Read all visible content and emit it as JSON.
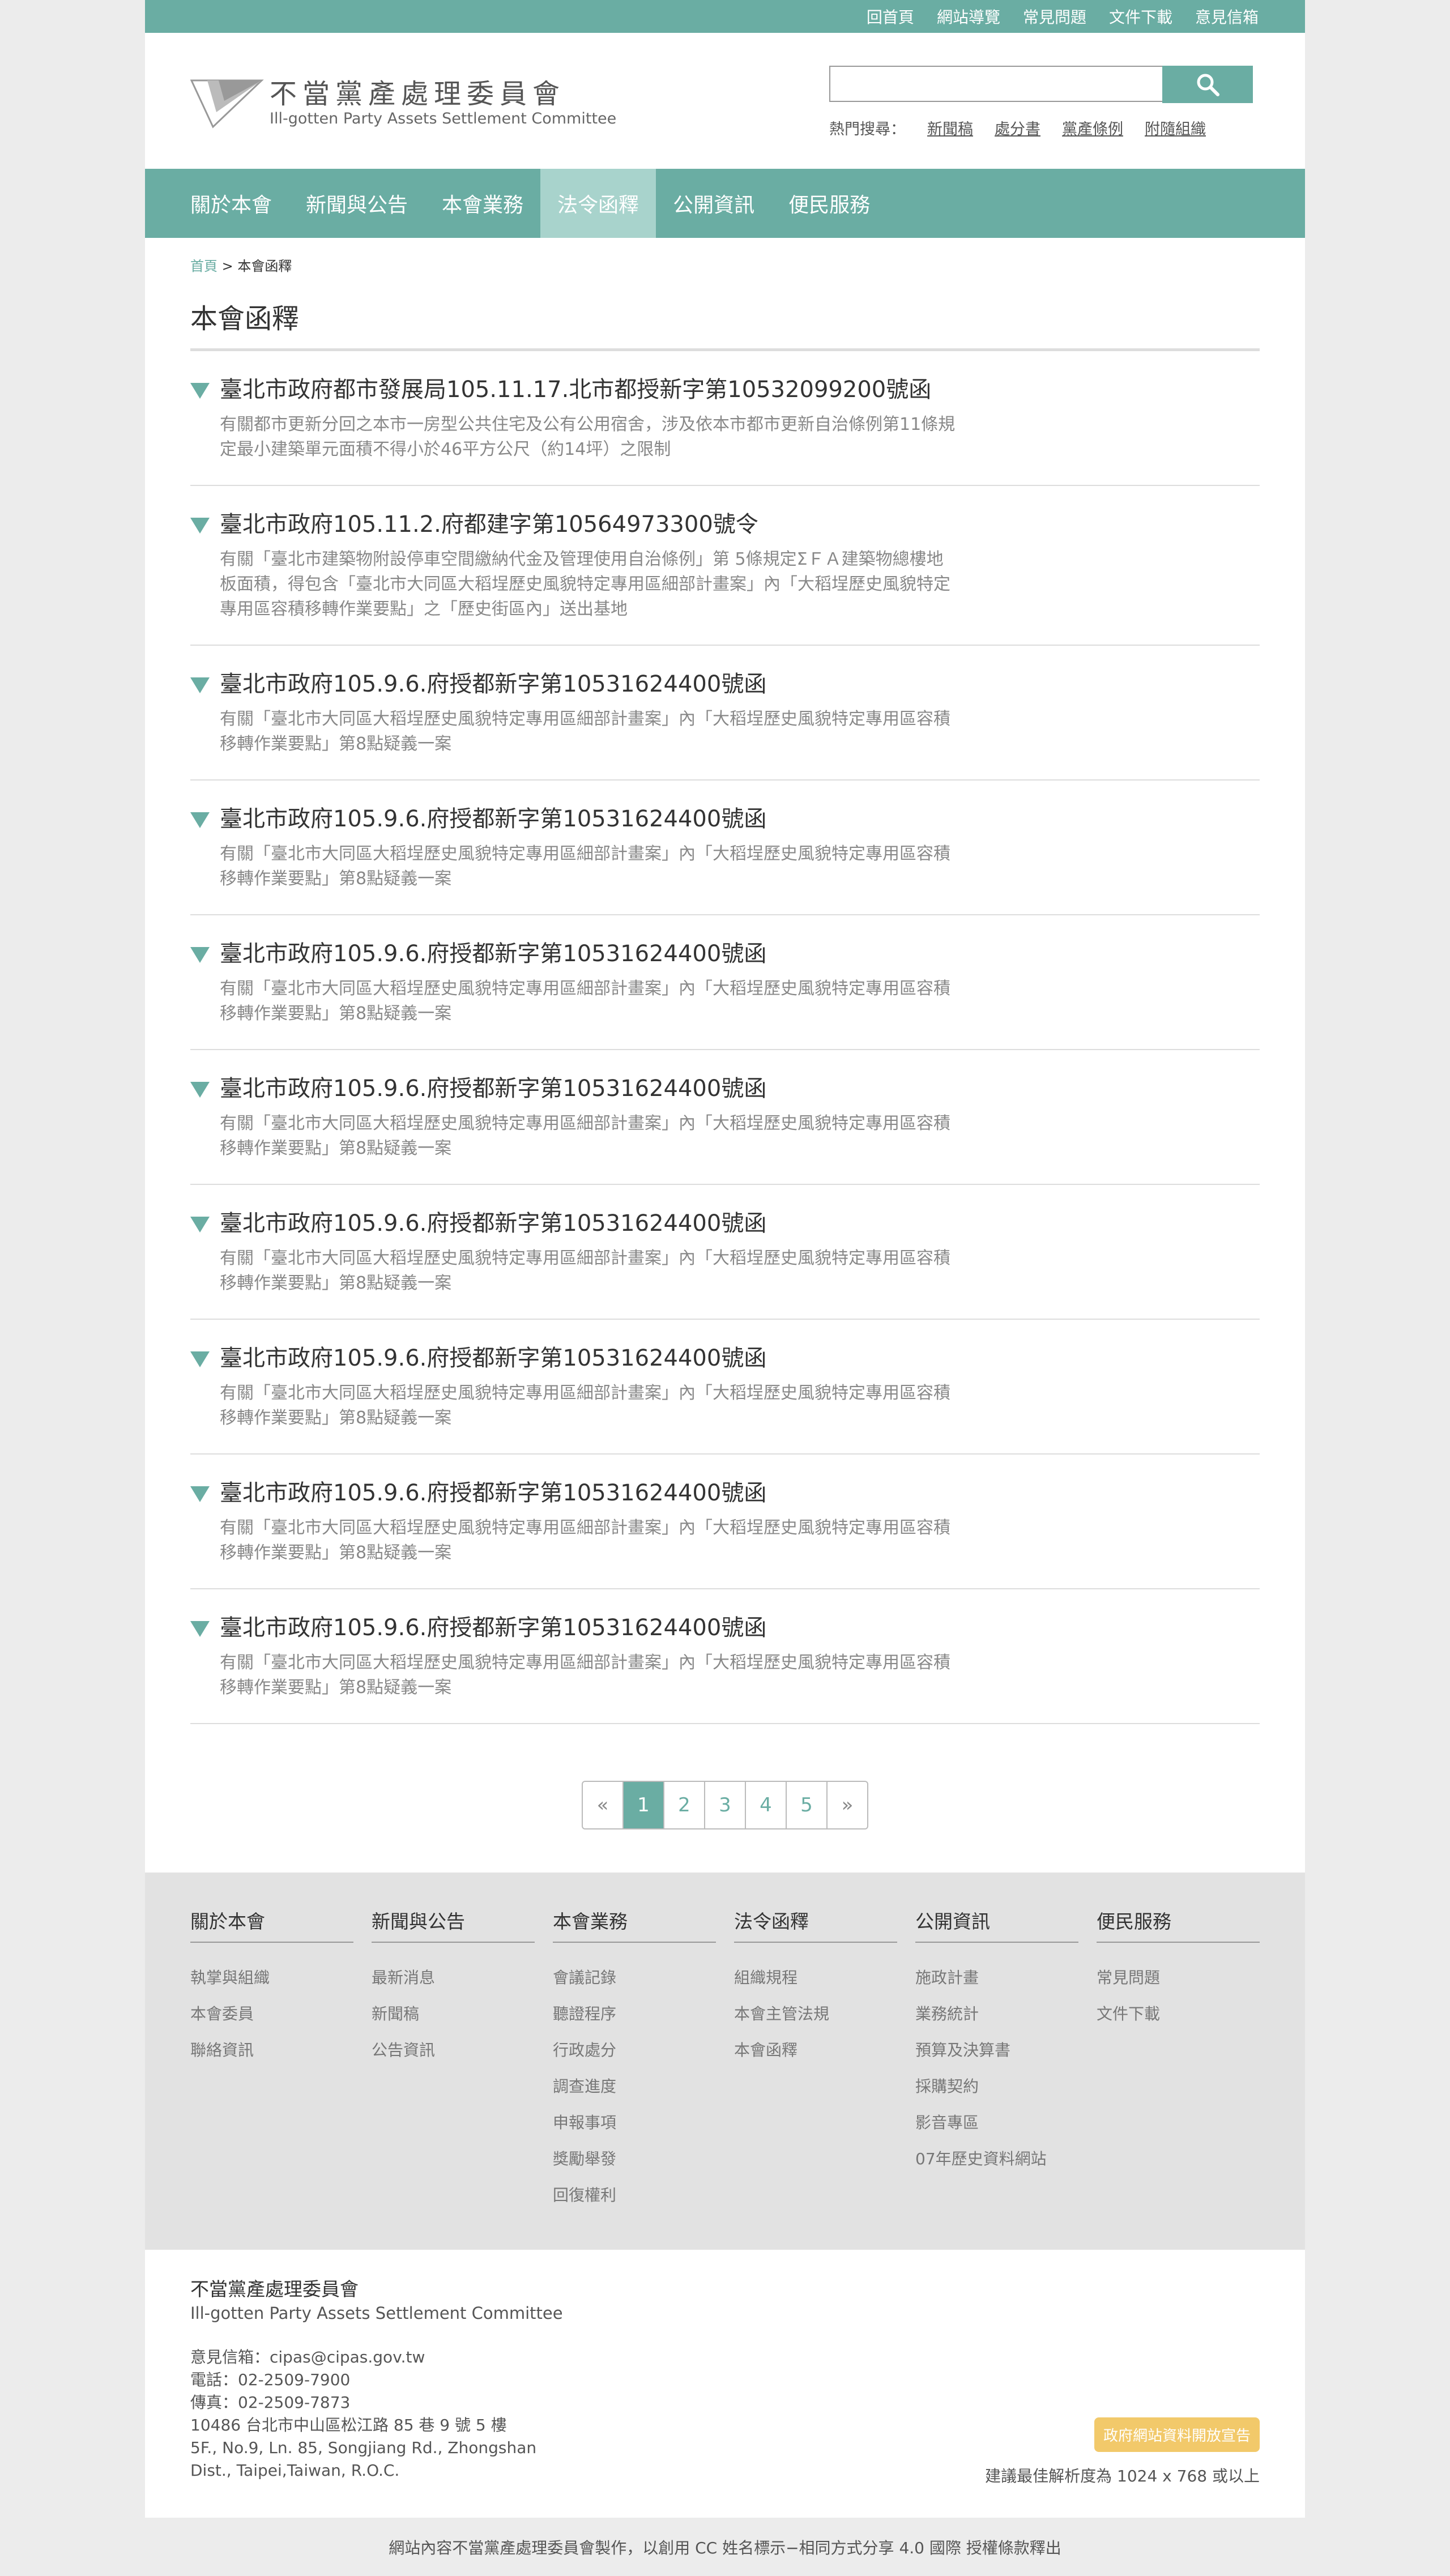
{
  "topbar": {
    "links": [
      "回首頁",
      "網站導覽",
      "常見問題",
      "文件下載",
      "意見信箱"
    ]
  },
  "header": {
    "logo_cn": "不當黨產處理委員會",
    "logo_en": "Ill-gotten Party Assets Settlement Committee",
    "search_value": "",
    "hot_label": "熱門搜尋：",
    "hot_links": [
      "新聞稿",
      "處分書",
      "黨產條例",
      "附隨組織"
    ]
  },
  "nav": {
    "items": [
      "關於本會",
      "新聞與公告",
      "本會業務",
      "法令函釋",
      "公開資訊",
      "便民服務"
    ],
    "active": "法令函釋"
  },
  "breadcrumb": {
    "home": "首頁",
    "sep": " > ",
    "current": "本會函釋"
  },
  "page_title": "本會函釋",
  "items": [
    {
      "title": "臺北市政府都市發展局105.11.17.北市都授新字第10532099200號函",
      "desc": "有關都市更新分回之本市一房型公共住宅及公有公用宿舍，涉及依本市都市更新自治條例第11條規定最小建築單元面積不得小於46平方公尺（約14坪）之限制"
    },
    {
      "title": "臺北市政府105.11.2.府都建字第10564973300號令",
      "desc": "有關「臺北市建築物附設停車空間繳納代金及管理使用自治條例」第 5條規定ΣＦＡ建築物總樓地板面積，得包含「臺北市大同區大稻埕歷史風貌特定專用區細部計畫案」內「大稻埕歷史風貌特定專用區容積移轉作業要點」之「歷史街區內」送出基地"
    },
    {
      "title": "臺北市政府105.9.6.府授都新字第10531624400號函",
      "desc": "有關「臺北市大同區大稻埕歷史風貌特定專用區細部計畫案」內「大稻埕歷史風貌特定專用區容積移轉作業要點」第8點疑義一案"
    },
    {
      "title": "臺北市政府105.9.6.府授都新字第10531624400號函",
      "desc": "有關「臺北市大同區大稻埕歷史風貌特定專用區細部計畫案」內「大稻埕歷史風貌特定專用區容積移轉作業要點」第8點疑義一案"
    },
    {
      "title": "臺北市政府105.9.6.府授都新字第10531624400號函",
      "desc": "有關「臺北市大同區大稻埕歷史風貌特定專用區細部計畫案」內「大稻埕歷史風貌特定專用區容積移轉作業要點」第8點疑義一案"
    },
    {
      "title": "臺北市政府105.9.6.府授都新字第10531624400號函",
      "desc": "有關「臺北市大同區大稻埕歷史風貌特定專用區細部計畫案」內「大稻埕歷史風貌特定專用區容積移轉作業要點」第8點疑義一案"
    },
    {
      "title": "臺北市政府105.9.6.府授都新字第10531624400號函",
      "desc": "有關「臺北市大同區大稻埕歷史風貌特定專用區細部計畫案」內「大稻埕歷史風貌特定專用區容積移轉作業要點」第8點疑義一案"
    },
    {
      "title": "臺北市政府105.9.6.府授都新字第10531624400號函",
      "desc": "有關「臺北市大同區大稻埕歷史風貌特定專用區細部計畫案」內「大稻埕歷史風貌特定專用區容積移轉作業要點」第8點疑義一案"
    },
    {
      "title": "臺北市政府105.9.6.府授都新字第10531624400號函",
      "desc": "有關「臺北市大同區大稻埕歷史風貌特定專用區細部計畫案」內「大稻埕歷史風貌特定專用區容積移轉作業要點」第8點疑義一案"
    },
    {
      "title": "臺北市政府105.9.6.府授都新字第10531624400號函",
      "desc": "有關「臺北市大同區大稻埕歷史風貌特定專用區細部計畫案」內「大稻埕歷史風貌特定專用區容積移轉作業要點」第8點疑義一案"
    }
  ],
  "pager": {
    "prev": "«",
    "pages": [
      "1",
      "2",
      "3",
      "4",
      "5"
    ],
    "current": "1",
    "next": "»"
  },
  "sitemap": [
    {
      "head": "關於本會",
      "links": [
        "執掌與組織",
        "本會委員",
        "聯絡資訊"
      ]
    },
    {
      "head": "新聞與公告",
      "links": [
        "最新消息",
        "新聞稿",
        "公告資訊"
      ]
    },
    {
      "head": "本會業務",
      "links": [
        "會議記錄",
        "聽證程序",
        "行政處分",
        "調查進度",
        "申報事項",
        "獎勵舉發",
        "回復權利"
      ]
    },
    {
      "head": "法令函釋",
      "links": [
        "組織規程",
        "本會主管法規",
        "本會函釋"
      ]
    },
    {
      "head": "公開資訊",
      "links": [
        "施政計畫",
        "業務統計",
        "預算及決算書",
        "採購契約",
        "影音專區",
        "07年歷史資料網站"
      ]
    },
    {
      "head": "便民服務",
      "links": [
        "常見問題",
        "文件下載"
      ]
    }
  ],
  "footer": {
    "org": "不當黨產處理委員會",
    "org_en": "Ill-gotten Party Assets Settlement Committee",
    "lines": [
      "意見信箱：cipas@cipas.gov.tw",
      "電話：02-2509-7900",
      "傳真：02-2509-7873",
      "10486 台北市中山區松江路 85 巷 9 號 5 樓",
      "5F., No.9, Ln. 85, Songjiang Rd., Zhongshan",
      "Dist., Taipei,Taiwan, R.O.C."
    ],
    "open_badge": "政府網站資料開放宣告",
    "resolution": "建議最佳解析度為 1024 x 768 或以上",
    "license": "網站內容不當黨產處理委員會製作，以創用 CC 姓名標示−相同方式分享 4.0 國際 授權條款釋出"
  },
  "colors": {
    "accent": "#6aada3",
    "accent_light": "#a8d3cc",
    "badge": "#f2c96a"
  }
}
